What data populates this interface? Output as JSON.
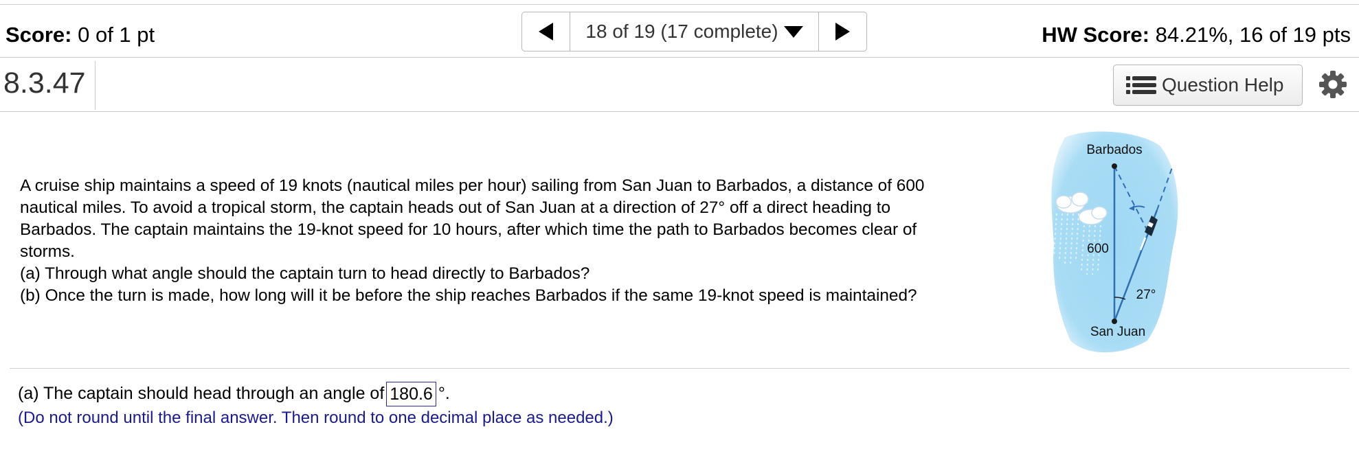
{
  "header": {
    "score_label": "Score:",
    "score_value": "0 of 1 pt",
    "nav_status": "18 of 19 (17 complete)",
    "hw_label": "HW Score:",
    "hw_value": "84.21%, 16 of 19 pts"
  },
  "question_bar": {
    "number": "8.3.47",
    "help_label": "Question Help"
  },
  "problem": {
    "lines": [
      "A cruise ship maintains a speed of 19 knots (nautical miles per hour) sailing from San Juan to Barbados, a distance of 600",
      "nautical miles.  To avoid a tropical storm, the captain heads out of San Juan at a direction of 27° off a direct heading to",
      "Barbados.  The captain maintains the 19-knot speed for 10 hours, after which time the path to Barbados becomes clear of",
      "storms.",
      "(a) Through what angle should the captain turn to head directly to Barbados?",
      "(b) Once the turn is made, how long will it be before the ship reaches Barbados if the same 19-knot speed is maintained?"
    ]
  },
  "diagram": {
    "top_label": "Barbados",
    "distance_label": "600",
    "angle_label": "27°",
    "bottom_label": "San Juan",
    "water_color": "#a9dcf5",
    "line_color": "#2f6fb3"
  },
  "answer": {
    "part_a_prefix": "(a) The captain should head through an angle of",
    "part_a_value": "180.6",
    "part_a_suffix": "°.",
    "hint": "(Do not round until the final answer. Then round to one decimal place as needed.)"
  },
  "icons": {
    "prev": "triangle-left-icon",
    "next": "triangle-right-icon",
    "dropdown": "caret-down-icon",
    "help": "list-icon",
    "settings": "gear-icon"
  }
}
